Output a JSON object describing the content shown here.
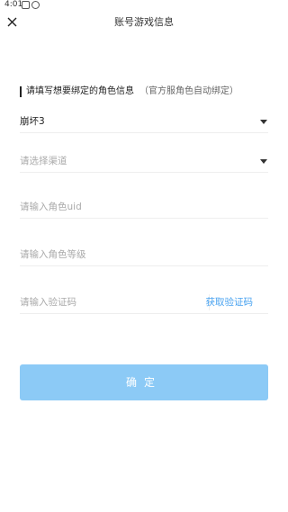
{
  "status_bar": {
    "time": "4:01"
  },
  "header": {
    "title": "账号游戏信息"
  },
  "form": {
    "heading": "请填写想要绑定的角色信息",
    "heading_note": "（官方服角色自动绑定）",
    "game_value": "崩坏3",
    "channel_placeholder": "请选择渠道",
    "uid_placeholder": "请输入角色uid",
    "level_placeholder": "请输入角色等级",
    "code_placeholder": "请输入验证码",
    "get_code_label": "获取验证码",
    "confirm_label": "确定"
  },
  "colors": {
    "accent": "#4aa3f0",
    "button_disabled": "#8ccaf6"
  }
}
